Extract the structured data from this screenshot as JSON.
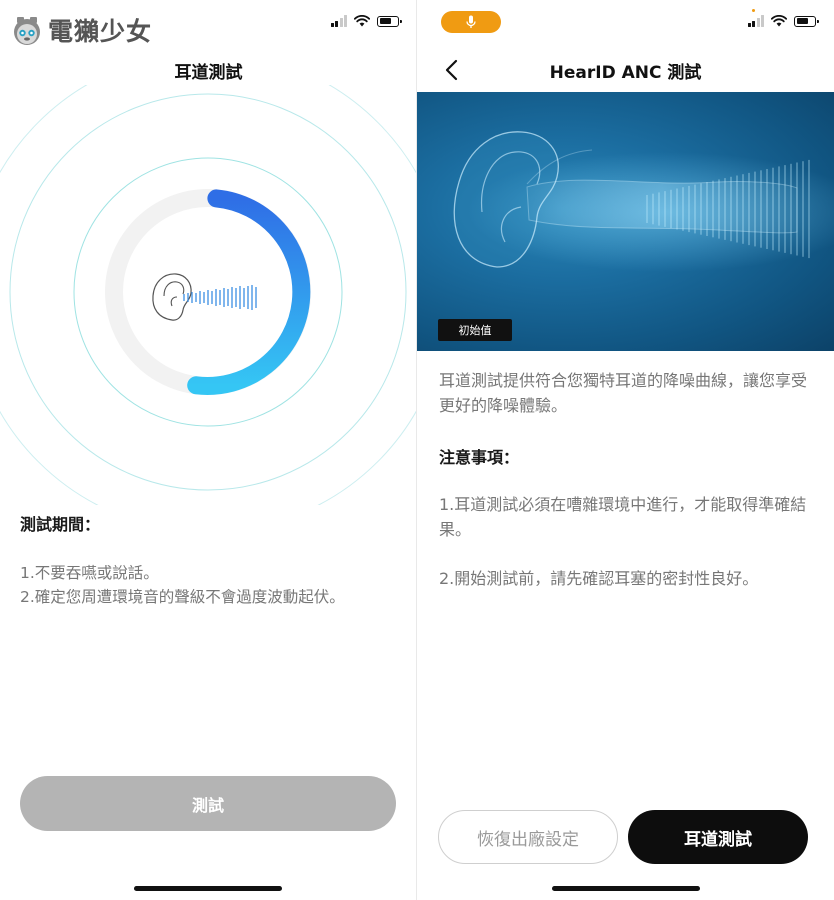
{
  "watermark": {
    "text": "電獺少女"
  },
  "left_screen": {
    "title": "耳道測試",
    "progress_fraction": 0.52,
    "section_heading": "測試期間：",
    "notes": [
      "1.不要吞嚥或說話。",
      "2.確定您周遭環境音的聲級不會過度波動起伏。"
    ],
    "test_button_label": "測試"
  },
  "right_screen": {
    "title": "HearID ANC 測試",
    "hero_badge": "初始值",
    "description": "耳道測試提供符合您獨特耳道的降噪曲線，讓您享受更好的降噪體驗。",
    "notes_heading": "注意事項：",
    "notes": [
      "1.耳道測試必須在嘈雜環境中進行，才能取得準確結果。",
      "2.開始測試前，請先確認耳塞的密封性良好。"
    ],
    "reset_button_label": "恢復出廠設定",
    "ear_test_button_label": "耳道測試"
  },
  "colors": {
    "progress_start": "#2f6ee6",
    "progress_end": "#35c6f4",
    "ring_track": "#f2f2f2",
    "ring_lines": "#9fe3e3",
    "disabled_button": "#b4b4b4",
    "primary_button": "#0d0d0d",
    "mic_indicator": "#f09b12",
    "hero_blue": "#1b6da0"
  },
  "icons": {
    "signal": "signal-bars-icon",
    "wifi": "wifi-icon",
    "battery": "battery-icon",
    "back": "chevron-left-icon",
    "mic": "microphone-icon",
    "ear": "ear-illustration"
  }
}
